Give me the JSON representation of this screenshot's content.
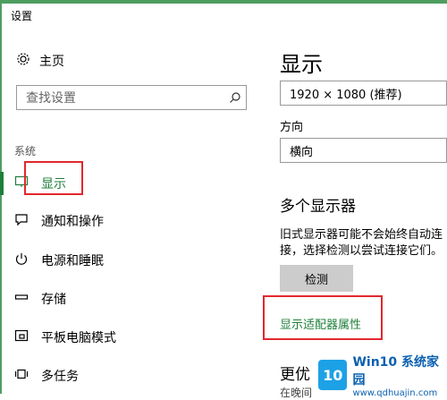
{
  "window": {
    "title": "设置"
  },
  "sidebar": {
    "home_label": "主页",
    "search_placeholder": "查找设置",
    "section_label": "系统",
    "items": [
      {
        "label": "显示",
        "icon": "monitor-icon",
        "active": true
      },
      {
        "label": "通知和操作",
        "icon": "message-icon"
      },
      {
        "label": "电源和睡眠",
        "icon": "power-icon"
      },
      {
        "label": "存储",
        "icon": "storage-icon"
      },
      {
        "label": "平板电脑模式",
        "icon": "tablet-mode-icon"
      },
      {
        "label": "多任务",
        "icon": "multitask-icon"
      }
    ]
  },
  "main": {
    "title": "显示",
    "resolution_value": "1920 × 1080 (推荐)",
    "orientation_label": "方向",
    "orientation_value": "横向",
    "multi_display_heading": "多个显示器",
    "multi_display_desc": "旧式显示器可能不会始终自动连接，选择检测以尝试连接它们。",
    "detect_button": "检测",
    "adapter_link": "显示适配器属性",
    "more_heading": "更优",
    "more_sub": "在晚间"
  },
  "watermark": {
    "logo_text": "10",
    "main_text": "Win10 系统家园",
    "sub_text": "www.qdhuajin.com"
  },
  "colors": {
    "accent_green": "#1e7f3a",
    "annotation_red": "#e2272d",
    "frame_green": "#4e9d61"
  }
}
